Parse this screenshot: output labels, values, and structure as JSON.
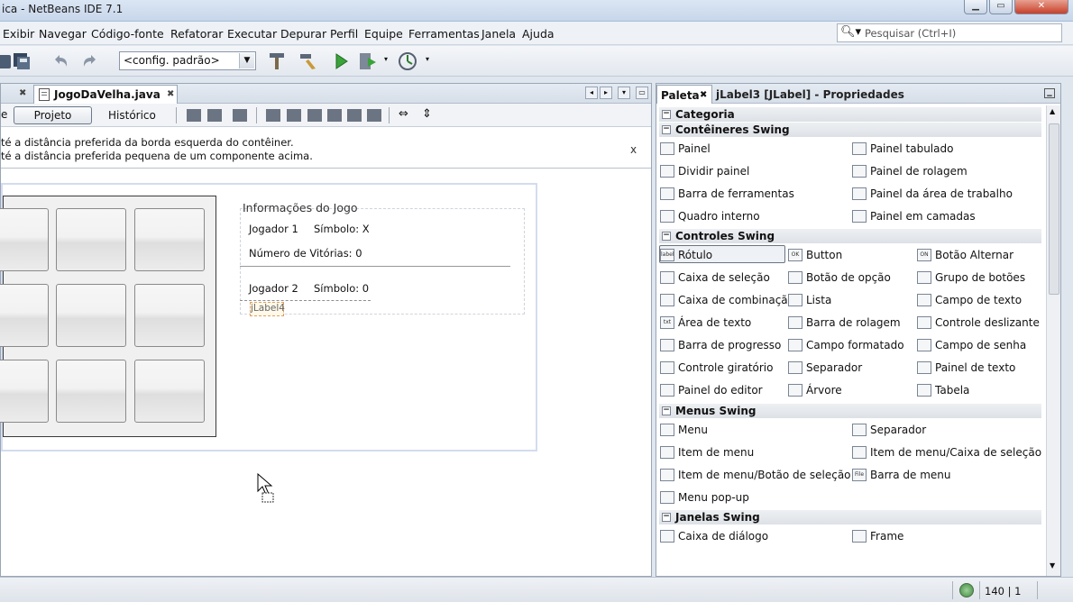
{
  "window": {
    "title": "ica - NetBeans IDE 7.1"
  },
  "menu": [
    "Exibir",
    "Navegar",
    "Código-fonte",
    "Refatorar",
    "Executar",
    "Depurar",
    "Perfil",
    "Equipe",
    "Ferramentas",
    "Janela",
    "Ajuda"
  ],
  "search": {
    "placeholder": "Pesquisar (Ctrl+I)"
  },
  "toolbar": {
    "config": "<config. padrão>"
  },
  "editor": {
    "file_tab": "JogoDaVelha.java",
    "design_tabs": {
      "source": "e",
      "design": "Projeto",
      "history": "Histórico"
    },
    "hint": {
      "line1": "té a distância preferida da borda esquerda do contêiner.",
      "line2": "té a distância preferida pequena de um componente acima.",
      "close": "x"
    },
    "info": {
      "title": "Informações do Jogo",
      "p1": "Jogador 1",
      "s1": "Símbolo: X",
      "wins": "Número de Vitórias: 0",
      "p2": "Jogador 2",
      "s2": "Símbolo: 0",
      "jlabel4": "jLabel4"
    }
  },
  "palette": {
    "tab": "Paleta",
    "props_tab": "jLabel3 [JLabel] - Propriedades",
    "categories": {
      "categoria": "Categoria",
      "containers": "Contêineres Swing",
      "controls": "Controles Swing",
      "menus": "Menus Swing",
      "windows": "Janelas Swing"
    },
    "containers": [
      "Painel",
      "Painel tabulado",
      "Dividir painel",
      "Painel de rolagem",
      "Barra de ferramentas",
      "Painel da área de trabalho",
      "Quadro interno",
      "Painel em camadas"
    ],
    "controls": [
      "Rótulo",
      "Button",
      "Botão Alternar",
      "Caixa de seleção",
      "Botão de opção",
      "Grupo de botões",
      "Caixa de combinação",
      "Lista",
      "Campo de texto",
      "Área de texto",
      "Barra de rolagem",
      "Controle deslizante",
      "Barra de progresso",
      "Campo formatado",
      "Campo de senha",
      "Controle giratório",
      "Separador",
      "Painel de texto",
      "Painel do editor",
      "Árvore",
      "Tabela"
    ],
    "menus": [
      "Menu",
      "Separador",
      "Item de menu",
      "Item de menu/Caixa de seleção",
      "Item de menu/Botão de seleção",
      "Barra de menu",
      "Menu pop-up"
    ],
    "windows": [
      "Caixa de diálogo",
      "Frame"
    ]
  },
  "status": {
    "position": "140 | 1"
  },
  "icons": {
    "label_icon": "label",
    "button_icon": "OK",
    "toggle_icon": "ON",
    "field_icon": "txt",
    "file_icon": "File"
  }
}
